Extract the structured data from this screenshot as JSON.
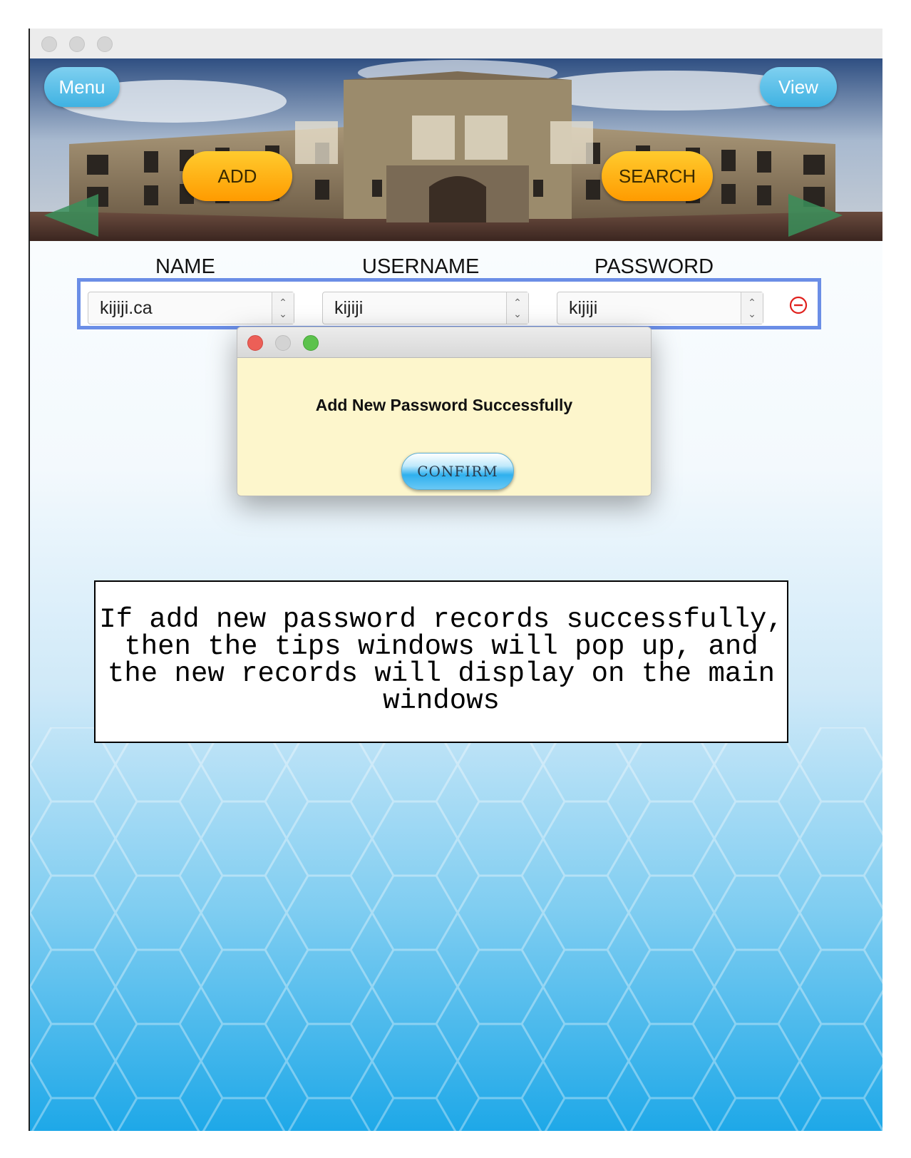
{
  "app": {
    "menu_label": "Menu",
    "view_label": "View",
    "add_label": "ADD",
    "search_label": "SEARCH"
  },
  "columns": {
    "name": "NAME",
    "username": "USERNAME",
    "password": "PASSWORD"
  },
  "record": {
    "name": "kijiji.ca",
    "username": "kijiji",
    "password": "kijiji"
  },
  "dialog": {
    "message": "Add New Password Successfully",
    "confirm_label": "CONFIRM"
  },
  "annotation": {
    "lines": [
      "If add new password records successfully,",
      "then the tips windows will pop up, and",
      "the new records will display on the main",
      "windows"
    ]
  },
  "colors": {
    "accent_blue": "#3fb2e2",
    "accent_orange": "#ff9b00",
    "row_border": "#6b8ee6",
    "dialog_bg": "#fdf6cc",
    "remove_red": "#e0201c"
  },
  "icons": {
    "remove": "minus-circle-icon",
    "prev": "left-arrow-icon",
    "next": "right-arrow-icon"
  }
}
